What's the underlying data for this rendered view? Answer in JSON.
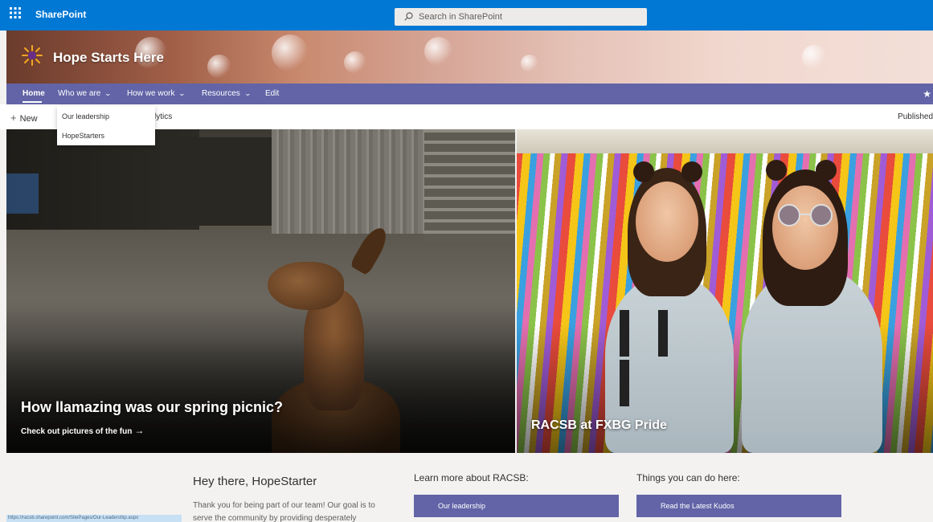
{
  "suite_bar": {
    "app_name": "SharePoint",
    "search_placeholder": "Search in SharePoint"
  },
  "site": {
    "title": "Hope Starts Here"
  },
  "nav": {
    "items": [
      {
        "label": "Home",
        "active": true,
        "has_menu": false
      },
      {
        "label": "Who we are",
        "active": false,
        "has_menu": true
      },
      {
        "label": "How we work",
        "active": false,
        "has_menu": true
      },
      {
        "label": "Resources",
        "active": false,
        "has_menu": true
      },
      {
        "label": "Edit",
        "active": false,
        "has_menu": false
      }
    ],
    "dropdown": {
      "items": [
        "Our leadership",
        "HopeStarters"
      ]
    }
  },
  "command_bar": {
    "new_label": "New",
    "analytics_label": "lytics",
    "published_label": "Published"
  },
  "hero": {
    "left": {
      "title": "How llamazing was our spring picnic?",
      "subtitle": "Check out pictures of the fun"
    },
    "right": {
      "title": "RACSB at FXBG Pride"
    }
  },
  "content": {
    "welcome": {
      "heading": "Hey there, HopeStarter",
      "text": "Thank you for being part of our team! Our goal is to serve the community by providing desperately"
    },
    "learn_more": {
      "heading": "Learn more about RACSB:",
      "button": "Our leadership"
    },
    "things_to_do": {
      "heading": "Things you can do here:",
      "button": "Read the Latest Kudos"
    }
  },
  "status_bar": {
    "url": "https://racsb.sharepoint.com/SitePages/Our-Leadership.aspx"
  },
  "colors": {
    "suite_bar": "#0078d4",
    "nav_bar": "#6264a7",
    "button": "#6264a7"
  }
}
